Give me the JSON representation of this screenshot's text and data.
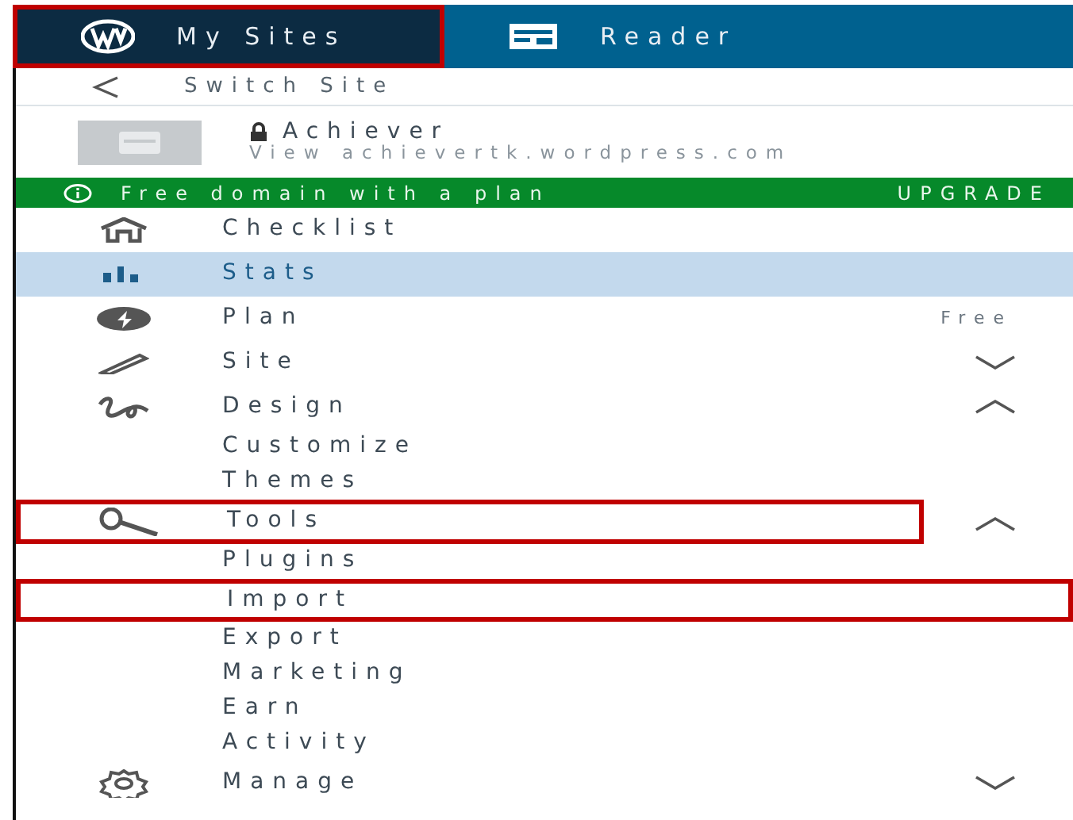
{
  "top_bar": [
    {
      "label": "My Sites",
      "selected": true,
      "highlighted": true
    },
    {
      "label": "Reader",
      "selected": false,
      "highlighted": false
    }
  ],
  "switch_site": {
    "label": "Switch Site"
  },
  "site": {
    "name": "Achiever",
    "url": "View achievertk.wordpress.com"
  },
  "banner": {
    "text": "Free domain with a plan",
    "action": "UPGRADE"
  },
  "menu": [
    {
      "label": "Checklist",
      "selected": false,
      "highlighted": false
    },
    {
      "label": "Stats",
      "selected": true,
      "highlighted": false
    },
    {
      "label": "Plan",
      "selected": false,
      "highlighted": false,
      "badge": "Free"
    },
    {
      "label": "Site",
      "selected": false,
      "highlighted": false,
      "expanded": false
    },
    {
      "label": "Design",
      "selected": false,
      "highlighted": false,
      "expanded": true,
      "children": [
        {
          "label": "Customize",
          "highlighted": false
        },
        {
          "label": "Themes",
          "highlighted": false
        }
      ]
    },
    {
      "label": "Tools",
      "selected": false,
      "highlighted": true,
      "expanded": true,
      "children": [
        {
          "label": "Plugins",
          "highlighted": false
        },
        {
          "label": "Import",
          "highlighted": true
        },
        {
          "label": "Export",
          "highlighted": false
        },
        {
          "label": "Marketing",
          "highlighted": false
        },
        {
          "label": "Earn",
          "highlighted": false
        },
        {
          "label": "Activity",
          "highlighted": false
        }
      ]
    },
    {
      "label": "Manage",
      "selected": false,
      "highlighted": false,
      "expanded": false
    }
  ]
}
